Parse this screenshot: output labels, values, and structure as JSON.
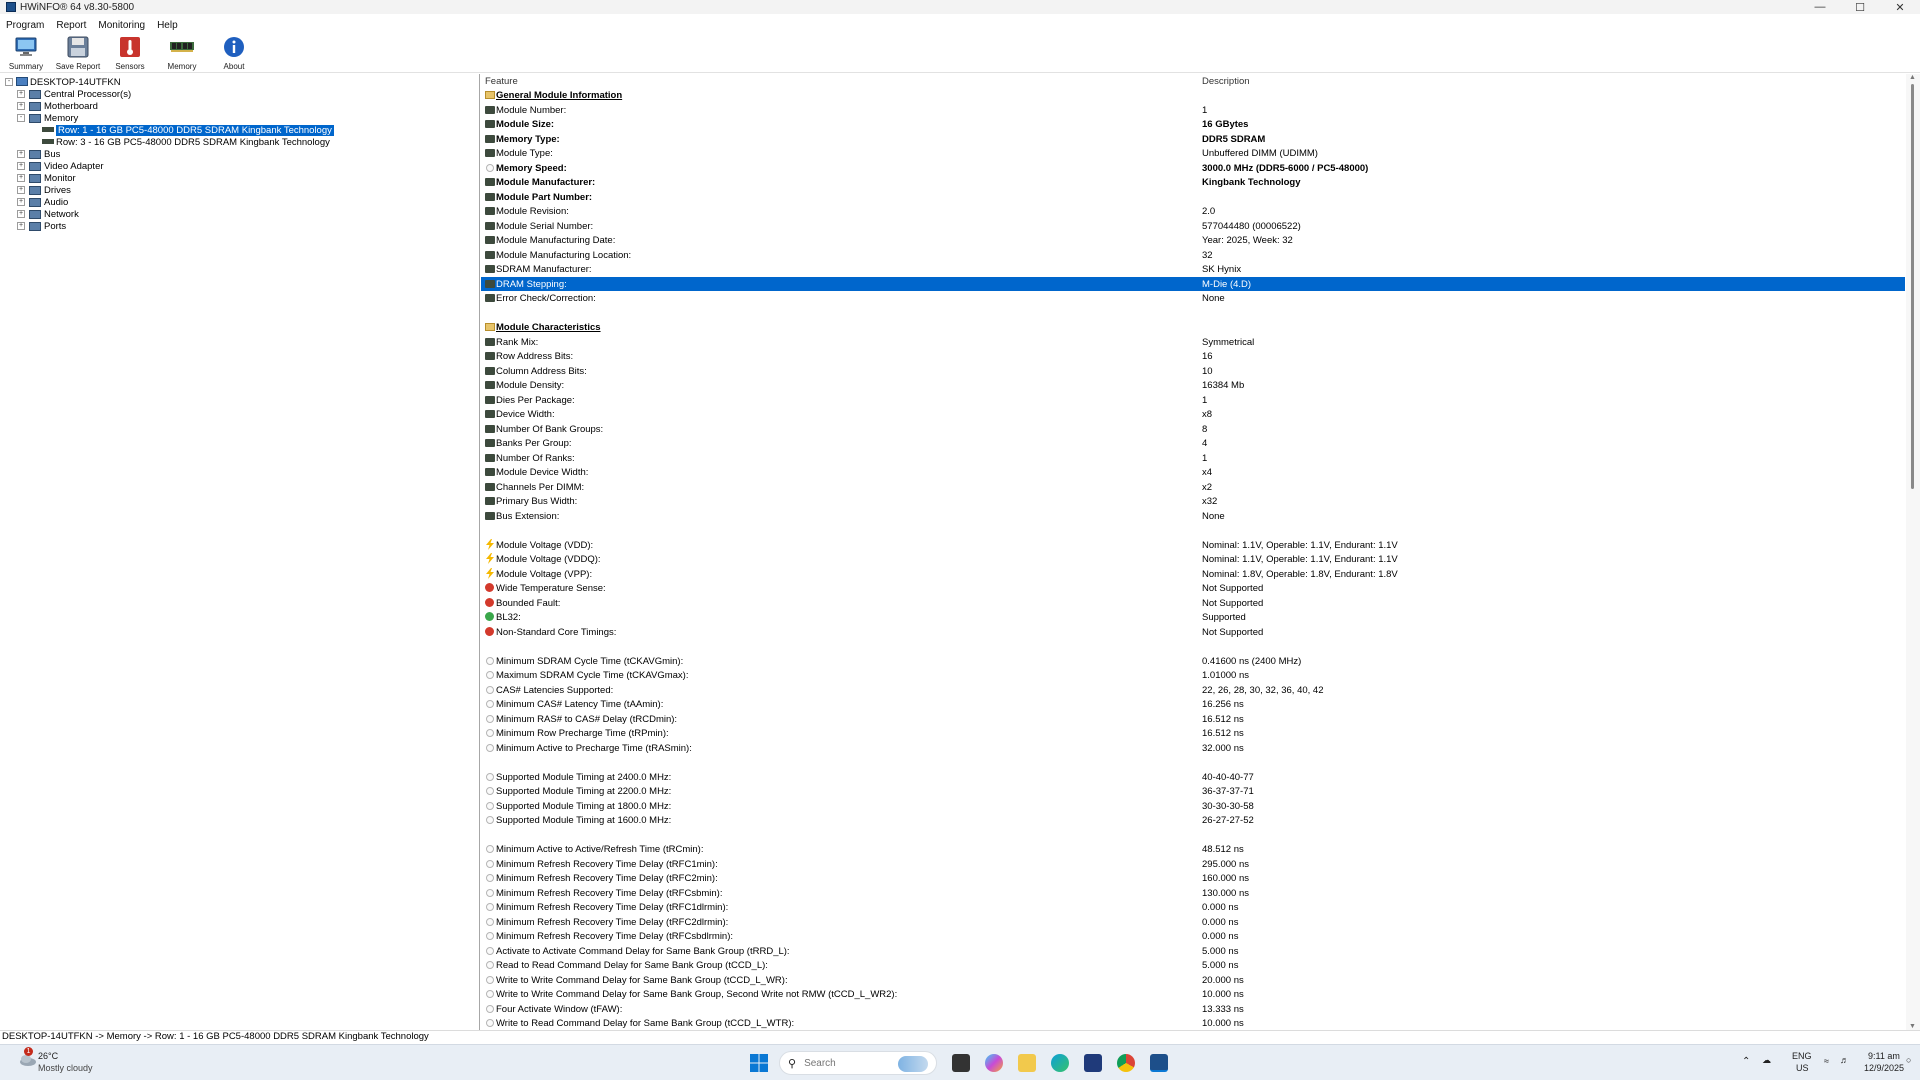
{
  "window": {
    "title": "HWiNFO® 64 v8.30-5800"
  },
  "menu": [
    "Program",
    "Report",
    "Monitoring",
    "Help"
  ],
  "toolbar": [
    {
      "label": "Summary",
      "icon": "monitor-icon"
    },
    {
      "label": "Save Report",
      "icon": "floppy-disk-icon"
    },
    {
      "label": "Sensors",
      "icon": "thermometer-icon"
    },
    {
      "label": "Memory",
      "icon": "memory-module-icon"
    },
    {
      "label": "About",
      "icon": "info-icon"
    }
  ],
  "tree": {
    "root": "DESKTOP-14UTFKN",
    "items": [
      {
        "label": "Central Processor(s)",
        "expander": "+"
      },
      {
        "label": "Motherboard",
        "expander": "+"
      },
      {
        "label": "Memory",
        "expander": "-"
      },
      {
        "label": "Row: 1 - 16 GB PC5-48000 DDR5 SDRAM Kingbank Technology",
        "child": true,
        "selected": true
      },
      {
        "label": "Row: 3 - 16 GB PC5-48000 DDR5 SDRAM Kingbank Technology",
        "child": true
      },
      {
        "label": "Bus",
        "expander": "+"
      },
      {
        "label": "Video Adapter",
        "expander": "+"
      },
      {
        "label": "Monitor",
        "expander": "+"
      },
      {
        "label": "Drives",
        "expander": "+"
      },
      {
        "label": "Audio",
        "expander": "+"
      },
      {
        "label": "Network",
        "expander": "+"
      },
      {
        "label": "Ports",
        "expander": "+"
      }
    ]
  },
  "details": {
    "header_feature": "Feature",
    "header_description": "Description",
    "rows": [
      {
        "f": "General Module Information",
        "d": "",
        "t": "section"
      },
      {
        "f": "Module Number:",
        "d": "1",
        "t": "mod"
      },
      {
        "f": "Module Size:",
        "d": "16 GBytes",
        "t": "mod",
        "b": true
      },
      {
        "f": "Memory Type:",
        "d": "DDR5 SDRAM",
        "t": "mod",
        "b": true
      },
      {
        "f": "Module Type:",
        "d": "Unbuffered DIMM (UDIMM)",
        "t": "mod"
      },
      {
        "f": "Memory Speed:",
        "d": "3000.0 MHz (DDR5-6000 / PC5-48000)",
        "t": "clock",
        "b": true
      },
      {
        "f": "Module Manufacturer:",
        "d": "Kingbank Technology",
        "t": "mod",
        "b": true
      },
      {
        "f": "Module Part Number:",
        "d": "",
        "t": "mod",
        "b": true
      },
      {
        "f": "Module Revision:",
        "d": "2.0",
        "t": "mod"
      },
      {
        "f": "Module Serial Number:",
        "d": "577044480 (00006522)",
        "t": "mod"
      },
      {
        "f": "Module Manufacturing Date:",
        "d": "Year: 2025, Week: 32",
        "t": "mod"
      },
      {
        "f": "Module Manufacturing Location:",
        "d": "32",
        "t": "mod"
      },
      {
        "f": "SDRAM Manufacturer:",
        "d": "SK Hynix",
        "t": "mod"
      },
      {
        "f": "DRAM Stepping:",
        "d": "M-Die (4.D)",
        "t": "mod",
        "sel": true
      },
      {
        "f": "Error Check/Correction:",
        "d": "None",
        "t": "mod"
      },
      {
        "f": "",
        "d": "",
        "t": "blank"
      },
      {
        "f": "Module Characteristics",
        "d": "",
        "t": "section"
      },
      {
        "f": "Rank Mix:",
        "d": "Symmetrical",
        "t": "mod"
      },
      {
        "f": "Row Address Bits:",
        "d": "16",
        "t": "mod"
      },
      {
        "f": "Column Address Bits:",
        "d": "10",
        "t": "mod"
      },
      {
        "f": "Module Density:",
        "d": "16384 Mb",
        "t": "mod"
      },
      {
        "f": "Dies Per Package:",
        "d": "1",
        "t": "mod"
      },
      {
        "f": "Device Width:",
        "d": "x8",
        "t": "mod"
      },
      {
        "f": "Number Of Bank Groups:",
        "d": "8",
        "t": "mod"
      },
      {
        "f": "Banks Per Group:",
        "d": "4",
        "t": "mod"
      },
      {
        "f": "Number Of Ranks:",
        "d": "1",
        "t": "mod"
      },
      {
        "f": "Module Device Width:",
        "d": "x4",
        "t": "mod"
      },
      {
        "f": "Channels Per DIMM:",
        "d": "x2",
        "t": "mod"
      },
      {
        "f": "Primary Bus Width:",
        "d": "x32",
        "t": "mod"
      },
      {
        "f": "Bus Extension:",
        "d": "None",
        "t": "mod"
      },
      {
        "f": "",
        "d": "",
        "t": "blank"
      },
      {
        "f": "Module Voltage (VDD):",
        "d": "Nominal: 1.1V, Operable: 1.1V, Endurant: 1.1V",
        "t": "bolt"
      },
      {
        "f": "Module Voltage (VDDQ):",
        "d": "Nominal: 1.1V, Operable: 1.1V, Endurant: 1.1V",
        "t": "bolt"
      },
      {
        "f": "Module Voltage (VPP):",
        "d": "Nominal: 1.8V, Operable: 1.8V, Endurant: 1.8V",
        "t": "bolt"
      },
      {
        "f": "Wide Temperature Sense:",
        "d": "Not Supported",
        "t": "no"
      },
      {
        "f": "Bounded Fault:",
        "d": "Not Supported",
        "t": "no"
      },
      {
        "f": "BL32:",
        "d": "Supported",
        "t": "yes"
      },
      {
        "f": "Non-Standard Core Timings:",
        "d": "Not Supported",
        "t": "no"
      },
      {
        "f": "",
        "d": "",
        "t": "blank"
      },
      {
        "f": "Minimum SDRAM Cycle Time (tCKAVGmin):",
        "d": "0.41600 ns (2400 MHz)",
        "t": "clock"
      },
      {
        "f": "Maximum SDRAM Cycle Time (tCKAVGmax):",
        "d": "1.01000 ns",
        "t": "clock"
      },
      {
        "f": "CAS# Latencies Supported:",
        "d": "22, 26, 28, 30, 32, 36, 40, 42",
        "t": "clock"
      },
      {
        "f": "Minimum CAS# Latency Time (tAAmin):",
        "d": "16.256 ns",
        "t": "clock"
      },
      {
        "f": "Minimum RAS# to CAS# Delay (tRCDmin):",
        "d": "16.512 ns",
        "t": "clock"
      },
      {
        "f": "Minimum Row Precharge Time (tRPmin):",
        "d": "16.512 ns",
        "t": "clock"
      },
      {
        "f": "Minimum Active to Precharge Time (tRASmin):",
        "d": "32.000 ns",
        "t": "clock"
      },
      {
        "f": "",
        "d": "",
        "t": "blank"
      },
      {
        "f": "Supported Module Timing at 2400.0 MHz:",
        "d": "40-40-40-77",
        "t": "clock"
      },
      {
        "f": "Supported Module Timing at 2200.0 MHz:",
        "d": "36-37-37-71",
        "t": "clock"
      },
      {
        "f": "Supported Module Timing at 1800.0 MHz:",
        "d": "30-30-30-58",
        "t": "clock"
      },
      {
        "f": "Supported Module Timing at 1600.0 MHz:",
        "d": "26-27-27-52",
        "t": "clock"
      },
      {
        "f": "",
        "d": "",
        "t": "blank"
      },
      {
        "f": "Minimum Active to Active/Refresh Time (tRCmin):",
        "d": "48.512 ns",
        "t": "clock"
      },
      {
        "f": "Minimum Refresh Recovery Time Delay (tRFC1min):",
        "d": "295.000 ns",
        "t": "clock"
      },
      {
        "f": "Minimum Refresh Recovery Time Delay (tRFC2min):",
        "d": "160.000 ns",
        "t": "clock"
      },
      {
        "f": "Minimum Refresh Recovery Time Delay (tRFCsbmin):",
        "d": "130.000 ns",
        "t": "clock"
      },
      {
        "f": "Minimum Refresh Recovery Time Delay (tRFC1dlrmin):",
        "d": "0.000 ns",
        "t": "clock"
      },
      {
        "f": "Minimum Refresh Recovery Time Delay (tRFC2dlrmin):",
        "d": "0.000 ns",
        "t": "clock"
      },
      {
        "f": "Minimum Refresh Recovery Time Delay (tRFCsbdlrmin):",
        "d": "0.000 ns",
        "t": "clock"
      },
      {
        "f": "Activate to Activate Command Delay for Same Bank Group (tRRD_L):",
        "d": "5.000 ns",
        "t": "clock"
      },
      {
        "f": "Read to Read Command Delay for Same Bank Group (tCCD_L):",
        "d": "5.000 ns",
        "t": "clock"
      },
      {
        "f": "Write to Write Command Delay for Same Bank Group (tCCD_L_WR):",
        "d": "20.000 ns",
        "t": "clock"
      },
      {
        "f": "Write to Write Command Delay for Same Bank Group, Second Write not RMW (tCCD_L_WR2):",
        "d": "10.000 ns",
        "t": "clock"
      },
      {
        "f": "Four Activate Window (tFAW):",
        "d": "13.333 ns",
        "t": "clock"
      },
      {
        "f": "Write to Read Command Delay for Same Bank Group (tCCD_L_WTR):",
        "d": "10.000 ns",
        "t": "clock"
      }
    ]
  },
  "statusbar": "DESKTOP-14UTFKN -> Memory -> Row: 1 - 16 GB PC5-48000 DDR5 SDRAM Kingbank Technology",
  "taskbar": {
    "weather_temp": "26°C",
    "weather_cond": "Mostly cloudy",
    "weather_badge": "1",
    "search_placeholder": "Search",
    "lang": "ENG",
    "region": "US",
    "time": "9:11 am",
    "date": "12/9/2025"
  },
  "colors": {
    "selection": "#0066cc",
    "section_icon": "#e7c46a",
    "error": "#d33a2c",
    "ok": "#3aa74b",
    "bolt": "#f5b800"
  }
}
